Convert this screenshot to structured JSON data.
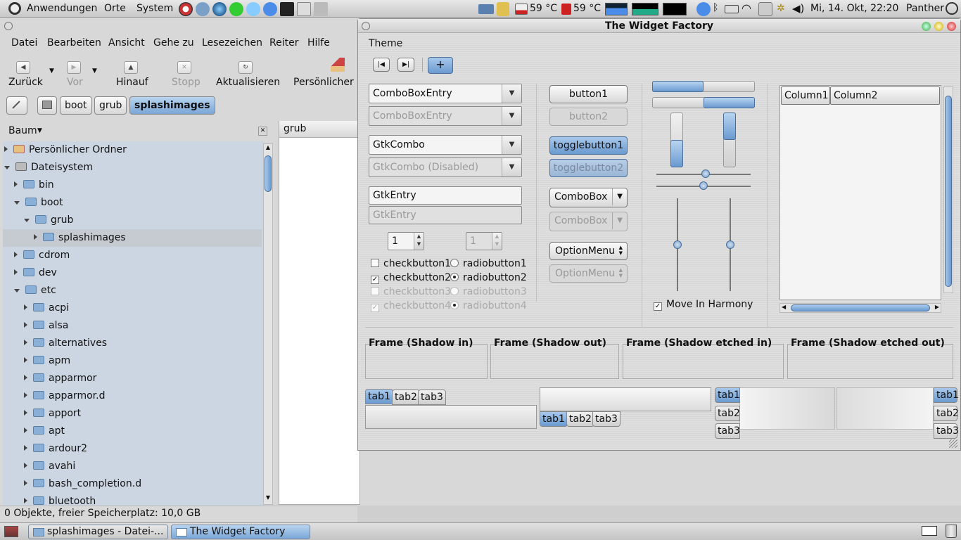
{
  "top_panel": {
    "menus": [
      "Anwendungen",
      "Orte",
      "System"
    ],
    "temp1": "59 °C",
    "temp2": "59 °C",
    "clock": "Mi, 14. Okt, 22:20",
    "user": "Panther"
  },
  "file_manager": {
    "menu": [
      "Datei",
      "Bearbeiten",
      "Ansicht",
      "Gehe zu",
      "Lesezeichen",
      "Reiter",
      "Hilfe"
    ],
    "toolbar": [
      "Zurück",
      "Vor",
      "Hinauf",
      "Stopp",
      "Aktualisieren",
      "Persönlicher O"
    ],
    "path": [
      "boot",
      "grub",
      "splashimages"
    ],
    "side_title": "Baum",
    "tab_label": "grub",
    "tree": [
      {
        "label": "Persönlicher Ordner",
        "indent": 0,
        "state": "closed",
        "icon": "home-icon"
      },
      {
        "label": "Dateisystem",
        "indent": 0,
        "state": "open",
        "icon": "drive-icon"
      },
      {
        "label": "bin",
        "indent": 1,
        "state": "closed"
      },
      {
        "label": "boot",
        "indent": 1,
        "state": "open"
      },
      {
        "label": "grub",
        "indent": 2,
        "state": "open"
      },
      {
        "label": "splashimages",
        "indent": 3,
        "state": "closed",
        "selected": true
      },
      {
        "label": "cdrom",
        "indent": 1,
        "state": "closed"
      },
      {
        "label": "dev",
        "indent": 1,
        "state": "closed"
      },
      {
        "label": "etc",
        "indent": 1,
        "state": "open"
      },
      {
        "label": "acpi",
        "indent": 2,
        "state": "closed"
      },
      {
        "label": "alsa",
        "indent": 2,
        "state": "closed"
      },
      {
        "label": "alternatives",
        "indent": 2,
        "state": "closed"
      },
      {
        "label": "apm",
        "indent": 2,
        "state": "closed"
      },
      {
        "label": "apparmor",
        "indent": 2,
        "state": "closed"
      },
      {
        "label": "apparmor.d",
        "indent": 2,
        "state": "closed"
      },
      {
        "label": "apport",
        "indent": 2,
        "state": "closed"
      },
      {
        "label": "apt",
        "indent": 2,
        "state": "closed"
      },
      {
        "label": "ardour2",
        "indent": 2,
        "state": "closed"
      },
      {
        "label": "avahi",
        "indent": 2,
        "state": "closed"
      },
      {
        "label": "bash_completion.d",
        "indent": 2,
        "state": "closed"
      },
      {
        "label": "bluetooth",
        "indent": 2,
        "state": "closed"
      }
    ],
    "status": "0 Objekte, freier Speicherplatz: 10,0 GB"
  },
  "widget_factory": {
    "title": "The Widget Factory",
    "theme_menu": "Theme",
    "combo_entry": "ComboBoxEntry",
    "combo_entry_dis": "ComboBoxEntry",
    "gtk_combo": "GtkCombo",
    "gtk_combo_dis": "GtkCombo (Disabled)",
    "entry": "GtkEntry",
    "entry_dis": "GtkEntry",
    "spin1": "1",
    "spin2": "1",
    "checks": [
      {
        "label": "checkbutton1",
        "checked": false,
        "disabled": false
      },
      {
        "label": "checkbutton2",
        "checked": true,
        "disabled": false
      },
      {
        "label": "checkbutton3",
        "checked": false,
        "disabled": true
      },
      {
        "label": "checkbutton4",
        "checked": true,
        "disabled": true
      }
    ],
    "radios": [
      {
        "label": "radiobutton1",
        "on": false,
        "disabled": false
      },
      {
        "label": "radiobutton2",
        "on": true,
        "disabled": false
      },
      {
        "label": "radiobutton3",
        "on": false,
        "disabled": true
      },
      {
        "label": "radiobutton4",
        "on": true,
        "disabled": true
      }
    ],
    "button1": "button1",
    "button2": "button2",
    "toggle1": "togglebutton1",
    "toggle2": "togglebutton2",
    "combobox": "ComboBox",
    "combobox_dis": "ComboBox",
    "optionmenu": "OptionMenu",
    "optionmenu_dis": "OptionMenu",
    "harmony": "Move In Harmony",
    "columns": [
      "Column1",
      "Column2"
    ],
    "frames": [
      "Frame (Shadow in)",
      "Frame (Shadow out)",
      "Frame (Shadow etched in)",
      "Frame (Shadow etched out)"
    ],
    "tabs": [
      "tab1",
      "tab2",
      "tab3"
    ]
  },
  "taskbar": {
    "items": [
      "splashimages - Datei-...",
      "The Widget Factory"
    ]
  },
  "accent": "#6a9ad0"
}
